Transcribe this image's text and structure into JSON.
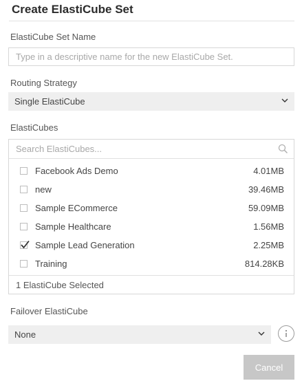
{
  "dialog": {
    "title": "Create ElastiCube Set"
  },
  "set_name": {
    "label": "ElastiCube Set Name",
    "value": "",
    "placeholder": "Type in a descriptive name for the new ElastiCube Set."
  },
  "routing": {
    "label": "Routing Strategy",
    "selected": "Single ElastiCube",
    "icon": "chevron-down-icon"
  },
  "elasticubes": {
    "label": "ElastiCubes",
    "search_placeholder": "Search ElastiCubes...",
    "search_icon": "search-icon",
    "items": [
      {
        "name": "Facebook Ads Demo",
        "size": "4.01MB",
        "checked": false
      },
      {
        "name": "new",
        "size": "39.46MB",
        "checked": false
      },
      {
        "name": "Sample ECommerce",
        "size": "59.09MB",
        "checked": false
      },
      {
        "name": "Sample Healthcare",
        "size": "1.56MB",
        "checked": false
      },
      {
        "name": "Sample Lead Generation",
        "size": "2.25MB",
        "checked": true
      },
      {
        "name": "Training",
        "size": "814.28KB",
        "checked": false
      }
    ],
    "summary": "1 ElastiCube Selected"
  },
  "failover": {
    "label": "Failover ElastiCube",
    "selected": "None",
    "info_icon": "info-icon"
  },
  "footer": {
    "cancel_label": "Cancel"
  },
  "colors": {
    "select_bg": "#efefef",
    "border": "#d7d7d7",
    "cancel_bg": "#c7c7c7",
    "check": "#333333"
  }
}
